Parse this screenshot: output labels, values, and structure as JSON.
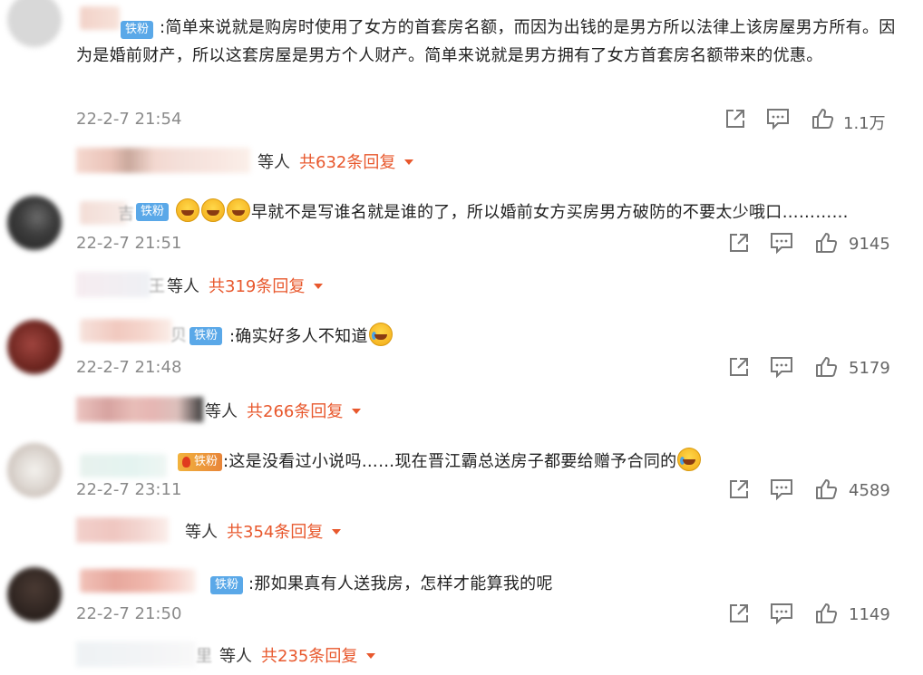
{
  "comments": [
    {
      "badge": "铁粉",
      "text": "简单来说就是购房时使用了女方的首套房名额，而因为出钱的是男方所以法律上该房屋男方所有。因为是婚前财产，所以这套房屋是男方个人财产。简单来说就是男方拥有了女方首套房名额带来的优惠。",
      "date": "22-2-7 21:54",
      "likes": "1.1万",
      "reply_suffix": "等人",
      "reply_count": "共632条回复"
    },
    {
      "name_tail": "吉",
      "badge": "铁粉",
      "text": "早就不是写谁名就是谁的了，所以婚前女方买房男方破防的不要太少哦口…………",
      "date": "22-2-7 21:51",
      "likes": "9145",
      "reply_name_tail": "王",
      "reply_suffix": "等人",
      "reply_count": "共319条回复"
    },
    {
      "name_tail": "贝",
      "badge": "铁粉",
      "text": "确实好多人不知道",
      "date": "22-2-7 21:48",
      "likes": "5179",
      "reply_suffix": "等人",
      "reply_count": "共266条回复"
    },
    {
      "badge": "铁粉",
      "text": "这是没看过小说吗……现在晋江霸总送房子都要给赠予合同的",
      "date": "22-2-7 23:11",
      "likes": "4589",
      "reply_suffix": "等人",
      "reply_count": "共354条回复"
    },
    {
      "badge": "铁粉",
      "text": "那如果真有人送我房，怎样才能算我的呢",
      "date": "22-2-7 21:50",
      "likes": "1149",
      "reply_name_tail": "里",
      "reply_suffix": "等人",
      "reply_count": "共235条回复"
    }
  ],
  "icons": {
    "share": "share-icon",
    "comment": "comment-icon",
    "like": "like-icon"
  },
  "colors": {
    "badge": "#5aa8e8",
    "reply_count": "#e8582d",
    "date": "#8a8a8a"
  }
}
